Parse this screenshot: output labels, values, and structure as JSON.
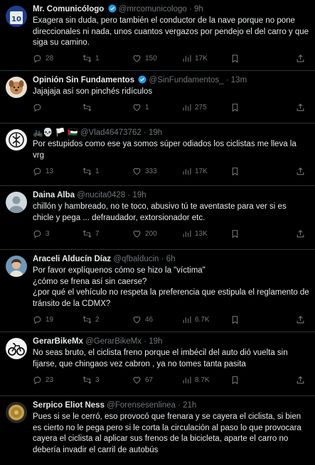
{
  "tweets": [
    {
      "name": "Mr. Comunicólogo",
      "verified": true,
      "handle": "@mrcomunicologo",
      "time": "9h",
      "text": "Exagera sin duda, pero también el conductor de la nave porque no pone direccionales ni nada, unos cuantos vergazos por pendejo el del carro y que siga su camino.",
      "replies": "28",
      "retweets": "1",
      "likes": "150",
      "views": "17K"
    },
    {
      "name": "Opinión Sin Fundamentos",
      "verified": true,
      "handle": "@SinFundamentos_",
      "time": "13m",
      "text": "Jajajaja así son pinchés ridículos",
      "replies": "",
      "retweets": "",
      "likes": "1",
      "views": "275"
    },
    {
      "name": "🚲💀 🏳️ 🇵🇸",
      "verified": false,
      "handle": "@Vlad46473762",
      "time": "19h",
      "text": "Por estupidos como ese ya somos súper odiados los ciclistas me lleva la vrg",
      "replies": "13",
      "retweets": "1",
      "likes": "333",
      "views": "17K"
    },
    {
      "name": "Daina Alba",
      "verified": false,
      "handle": "@nucita0428",
      "time": "19h",
      "text": "chillón y hambreado, no te toco, abusivo tú te aventaste para ver si es chicle y pega ... defraudador, extorsionador etc.",
      "replies": "3",
      "retweets": "7",
      "likes": "200",
      "views": "13K"
    },
    {
      "name": "Araceli Alducín Díaz",
      "verified": false,
      "handle": "@qfbalducin",
      "time": "6h",
      "text": "Por favor explíquenos cómo se hizo la \"víctima\"\n¿cómo se frena así sin caerse?\n¿por qué el vehículo no respeta la preferencia que estipula el reglamento de tránsito de la CDMX?",
      "replies": "19",
      "retweets": "2",
      "likes": "46",
      "views": "6.7K"
    },
    {
      "name": "GerarBikeMx",
      "verified": false,
      "handle": "@GerarBikeMx",
      "time": "19h",
      "text": "No seas bruto, el ciclista freno porque el imbécil del auto dió vuelta sin fijarse, que chingaos vez cabron , ya no tomes tanta pasita",
      "replies": "23",
      "retweets": "3",
      "likes": "67",
      "views": "8.7K"
    },
    {
      "name": "Serpico Eliot Ness",
      "verified": false,
      "handle": "@Forensesenlinea",
      "time": "21h",
      "text": "Pues si se le cerró, eso provocó que frenara y se cayera el ciclista, si bien es cierto no le pega pero si le corta la circulación al paso lo que provocara cayera el ciclista al aplicar sus frenos de la bicicleta, aparte el carro no debería invadir el carril de autobús",
      "replies": "",
      "retweets": "",
      "likes": "",
      "views": ""
    }
  ],
  "colors": {
    "background": "#000000",
    "text": "#e7e9ea",
    "muted": "#71767b",
    "divider": "#2f3336",
    "verified": "#1d9bf0"
  }
}
